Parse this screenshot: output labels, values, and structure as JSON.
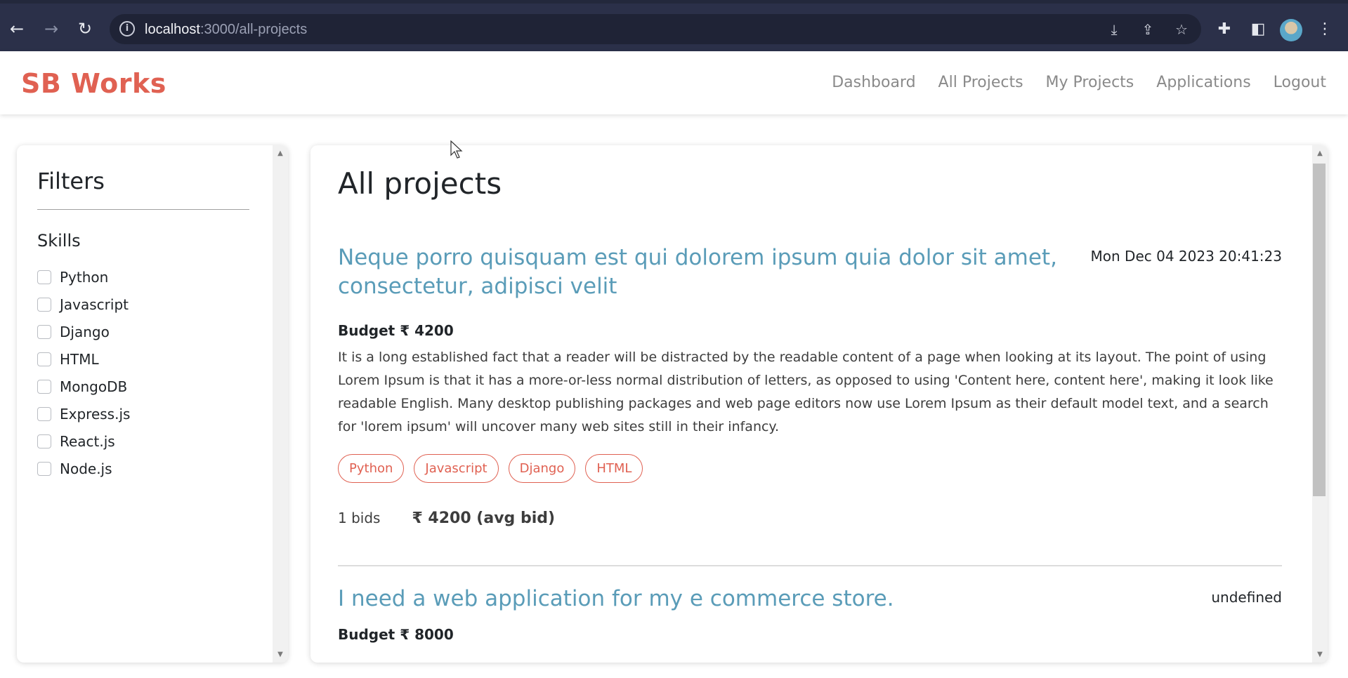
{
  "browser": {
    "url_host": "localhost",
    "url_path": ":3000/all-projects"
  },
  "app": {
    "brand": "SB Works",
    "nav": [
      "Dashboard",
      "All Projects",
      "My Projects",
      "Applications",
      "Logout"
    ]
  },
  "filters": {
    "title": "Filters",
    "skills_heading": "Skills",
    "skills": [
      "Python",
      "Javascript",
      "Django",
      "HTML",
      "MongoDB",
      "Express.js",
      "React.js",
      "Node.js"
    ]
  },
  "projects": {
    "title": "All projects",
    "items": [
      {
        "title": "Neque porro quisquam est qui dolorem ipsum quia dolor sit amet, consectetur, adipisci velit",
        "date": "Mon Dec 04 2023 20:41:23",
        "budget": "Budget ₹ 4200",
        "description": "It is a long established fact that a reader will be distracted by the readable content of a page when looking at its layout. The point of using Lorem Ipsum is that it has a more-or-less normal distribution of letters, as opposed to using 'Content here, content here', making it look like readable English. Many desktop publishing packages and web page editors now use Lorem Ipsum as their default model text, and a search for 'lorem ipsum' will uncover many web sites still in their infancy.",
        "tags": [
          "Python",
          "Javascript",
          "Django",
          "HTML"
        ],
        "bids": "1 bids",
        "avg_bid": "₹ 4200 (avg bid)"
      },
      {
        "title": "I need a web application for my e commerce store.",
        "date": "undefined",
        "budget": "Budget ₹ 8000"
      }
    ]
  }
}
